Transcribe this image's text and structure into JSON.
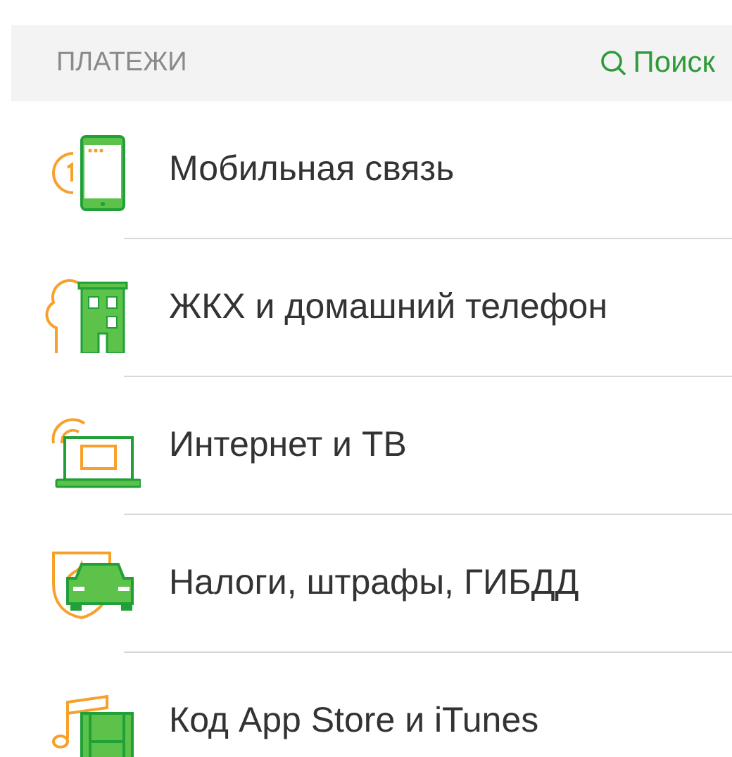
{
  "header": {
    "title": "ПЛАТЕЖИ",
    "search_label": "Поиск"
  },
  "items": [
    {
      "kind": "mobile",
      "label": "Мобильная связь"
    },
    {
      "kind": "utilities",
      "label": "ЖКХ и домашний телефон"
    },
    {
      "kind": "internet",
      "label": "Интернет и ТВ"
    },
    {
      "kind": "taxes",
      "label": "Налоги, штрафы, ГИБДД"
    },
    {
      "kind": "media",
      "label": "Код App Store и iTunes"
    }
  ]
}
